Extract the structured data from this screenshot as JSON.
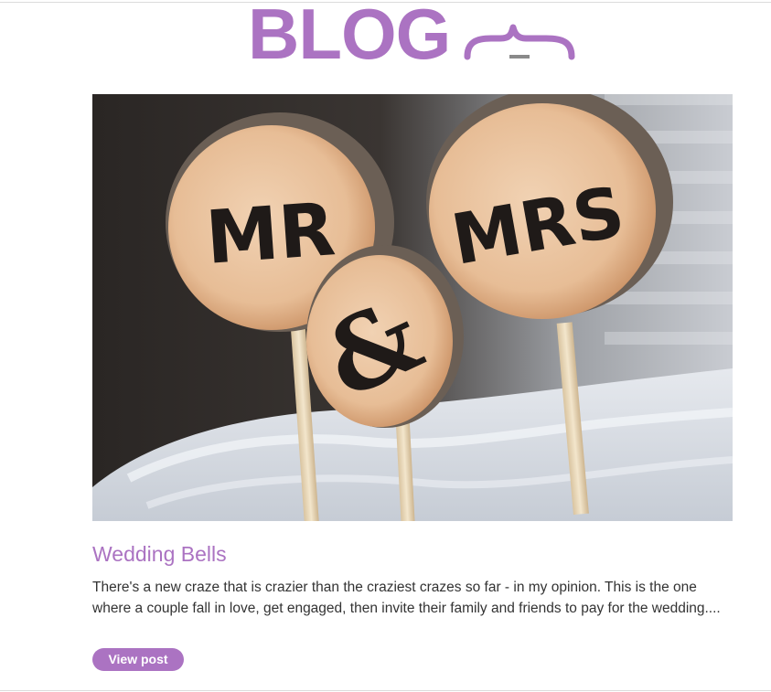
{
  "header": {
    "title": "BLOG",
    "accent_color": "#ab73c2",
    "decoration_icon": "curly-brace-icon"
  },
  "post": {
    "image_alt": "Wooden cake toppers reading MR & MRS on a white wedding cake",
    "image_text": {
      "left_disc": "MR",
      "middle_disc": "&",
      "right_disc": "MRS"
    },
    "title": "Wedding Bells",
    "excerpt": "There's a new craze that is crazier than the craziest crazes so far - in my opinion. This is the one where a couple fall in love, get engaged, then invite their family and friends to pay for the wedding....",
    "button_label": "View post"
  }
}
